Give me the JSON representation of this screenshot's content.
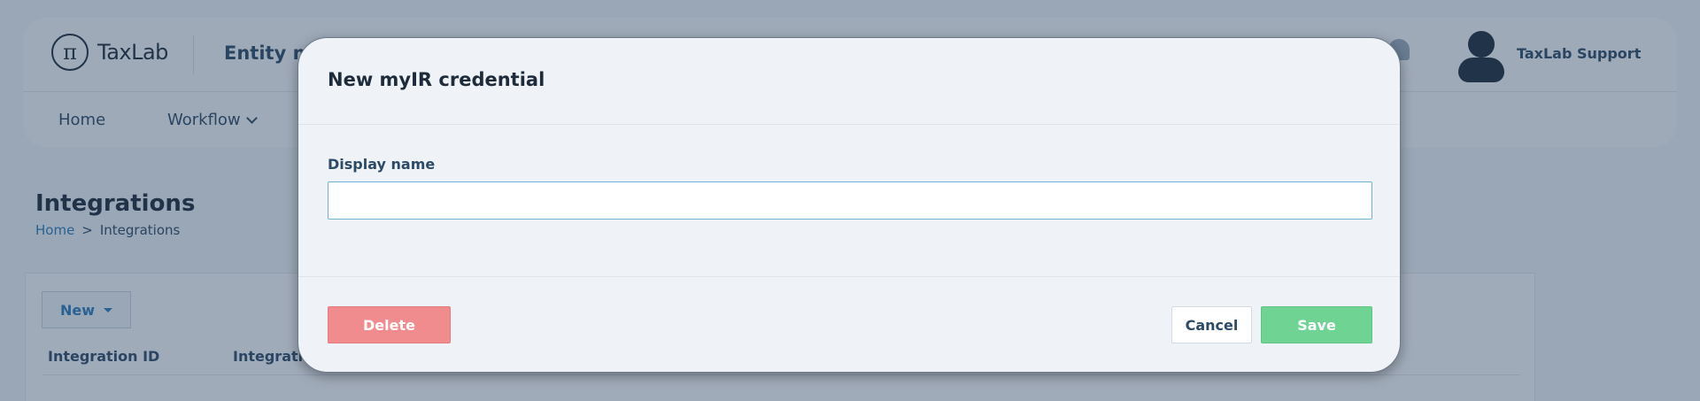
{
  "app": {
    "logo_symbol": "π",
    "logo_text": "TaxLab",
    "entity_title": "Entity m",
    "user_name": "TaxLab Support",
    "nav": [
      {
        "label": "Home"
      },
      {
        "label": "Workflow",
        "icon": "chevron-down-icon"
      }
    ]
  },
  "page": {
    "title": "Integrations",
    "breadcrumb": {
      "home": "Home",
      "separator": ">",
      "current": "Integrations"
    },
    "new_button": "New",
    "columns": [
      "Integration ID",
      "Integrati"
    ]
  },
  "modal": {
    "title": "New myIR credential",
    "display_name_label": "Display name",
    "display_name_value": "",
    "display_name_placeholder": "",
    "delete_label": "Delete",
    "cancel_label": "Cancel",
    "save_label": "Save"
  },
  "colors": {
    "accent": "#2a7ab8",
    "delete": "#f08c8e",
    "save": "#6fd393",
    "overlay": "#263e5c"
  }
}
